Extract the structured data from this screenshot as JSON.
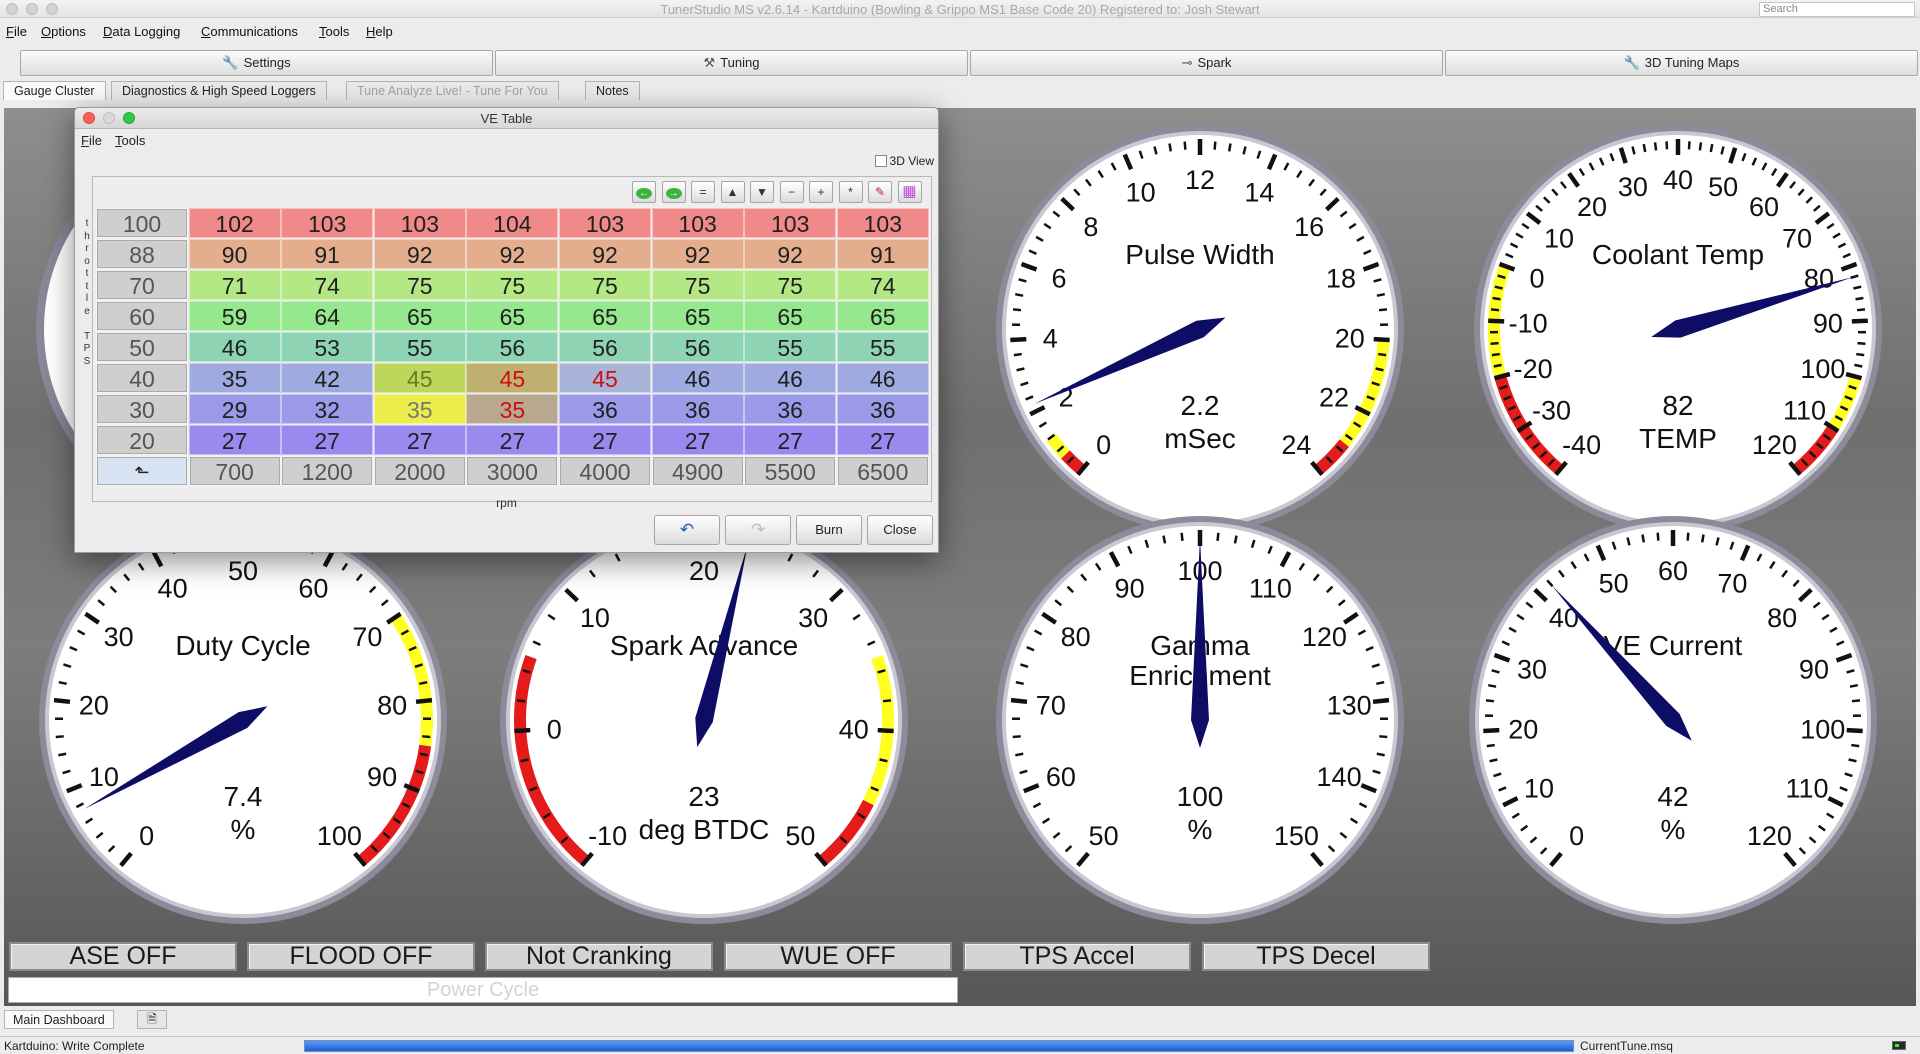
{
  "window": {
    "title": "TunerStudio MS v2.6.14 - Kartduino (Bowling & Grippo MS1 Base Code 20) Registered to: Josh Stewart",
    "search_placeholder": "Search"
  },
  "menubar": [
    "File",
    "Options",
    "Data Logging",
    "Communications",
    "Tools",
    "Help"
  ],
  "top_buttons": [
    {
      "label": "Settings",
      "icon": "wrench-icon"
    },
    {
      "label": "Tuning",
      "icon": "tools-icon"
    },
    {
      "label": "Spark",
      "icon": "spark-plug-icon"
    },
    {
      "label": "3D Tuning Maps",
      "icon": "map-wrench-icon"
    }
  ],
  "tabs": [
    {
      "label": "Gauge Cluster",
      "active": true
    },
    {
      "label": "Diagnostics & High Speed Loggers",
      "active": false
    },
    {
      "label": "Tune Analyze Live! - Tune For You",
      "active": false,
      "disabled": true
    },
    {
      "label": "Notes",
      "active": false
    }
  ],
  "gauges": [
    {
      "title": "Pulse Width",
      "value": "2.2",
      "units": "mSec",
      "min": 0,
      "max": 24,
      "reading": 2.2,
      "ticks": [
        0,
        2,
        4,
        6,
        8,
        10,
        12,
        14,
        16,
        18,
        20,
        22,
        24
      ],
      "zones": [
        {
          "from": 20,
          "to": 23,
          "color": "#ffff22"
        },
        {
          "from": 23,
          "to": 24,
          "color": "#e51a1a"
        },
        {
          "from": 0,
          "to": 0.6,
          "color": "#e51a1a"
        },
        {
          "from": 0.6,
          "to": 1.2,
          "color": "#ffff22"
        }
      ]
    },
    {
      "title": "Coolant Temp",
      "value": "82",
      "units": "TEMP",
      "min": -40,
      "max": 120,
      "reading": 82,
      "ticks": [
        -40,
        -30,
        -20,
        -10,
        0,
        10,
        20,
        30,
        40,
        50,
        60,
        70,
        80,
        90,
        100,
        110,
        120
      ],
      "zones": [
        {
          "from": -40,
          "to": -20,
          "color": "#e51a1a"
        },
        {
          "from": -20,
          "to": 0,
          "color": "#ffff22"
        },
        {
          "from": 100,
          "to": 110,
          "color": "#ffff22"
        },
        {
          "from": 110,
          "to": 120,
          "color": "#e51a1a"
        }
      ]
    },
    {
      "title": "Duty Cycle",
      "value": "7.4",
      "units": "%",
      "min": 0,
      "max": 100,
      "reading": 7.4,
      "ticks": [
        0,
        10,
        20,
        30,
        40,
        50,
        60,
        70,
        80,
        90,
        100
      ],
      "zones": [
        {
          "from": 70,
          "to": 85,
          "color": "#ffff22"
        },
        {
          "from": 85,
          "to": 100,
          "color": "#e51a1a"
        }
      ]
    },
    {
      "title": "Spark Advance",
      "value": "23",
      "units": "deg BTDC",
      "min": -10,
      "max": 50,
      "reading": 23,
      "ticks": [
        -10,
        0,
        10,
        20,
        30,
        40,
        50
      ],
      "zones": [
        {
          "from": -10,
          "to": 5,
          "color": "#e51a1a"
        },
        {
          "from": 35,
          "to": 45,
          "color": "#ffff22"
        },
        {
          "from": 45,
          "to": 50,
          "color": "#e51a1a"
        }
      ]
    },
    {
      "title": "Gamma Enrichment",
      "title_lines": [
        "Gamma",
        "Enrichment"
      ],
      "value": "100",
      "units": "%",
      "min": 50,
      "max": 150,
      "reading": 100,
      "ticks": [
        50,
        60,
        70,
        80,
        90,
        100,
        110,
        120,
        130,
        140,
        150
      ],
      "zones": []
    },
    {
      "title": "VE Current",
      "value": "42",
      "units": "%",
      "min": 0,
      "max": 120,
      "reading": 42,
      "ticks": [
        0,
        10,
        20,
        30,
        40,
        50,
        60,
        70,
        80,
        90,
        100,
        110,
        120
      ],
      "zones": []
    }
  ],
  "indicators": [
    "ASE OFF",
    "FLOOD OFF",
    "Not Cranking",
    "WUE OFF",
    "TPS Accel",
    "TPS Decel"
  ],
  "power_cycle": "Power Cycle",
  "bottom_tab": "Main Dashboard",
  "status": {
    "text": "Kartduino: Write Complete",
    "progress": 1.0,
    "file": "CurrentTune.msq"
  },
  "ve_table": {
    "title": "VE Table",
    "menu": [
      "File",
      "Tools"
    ],
    "view3d_label": "3D View",
    "y_axis_label": "throttle TPS",
    "x_axis_label": "rpm",
    "toolbar": [
      "arrow-left-icon",
      "arrow-right-icon",
      "=",
      "▲",
      "▼",
      "−",
      "+",
      "*",
      "pencil-icon",
      "color-palette-icon"
    ],
    "tps_bins": [
      "100",
      "88",
      "70",
      "60",
      "50",
      "40",
      "30",
      "20"
    ],
    "rpm_bins": [
      "700",
      "1200",
      "2000",
      "3000",
      "4000",
      "4900",
      "5500",
      "6500"
    ],
    "values": [
      [
        "102",
        "103",
        "103",
        "104",
        "103",
        "103",
        "103",
        "103"
      ],
      [
        "90",
        "91",
        "92",
        "92",
        "92",
        "92",
        "92",
        "91"
      ],
      [
        "71",
        "74",
        "75",
        "75",
        "75",
        "75",
        "75",
        "74"
      ],
      [
        "59",
        "64",
        "65",
        "65",
        "65",
        "65",
        "65",
        "65"
      ],
      [
        "46",
        "53",
        "55",
        "56",
        "56",
        "56",
        "55",
        "55"
      ],
      [
        "35",
        "42",
        "45",
        "45",
        "45",
        "46",
        "46",
        "46"
      ],
      [
        "29",
        "32",
        "35",
        "35",
        "36",
        "36",
        "36",
        "36"
      ],
      [
        "27",
        "27",
        "27",
        "27",
        "27",
        "27",
        "27",
        "27"
      ]
    ],
    "row_colors": [
      "#f08a8a",
      "#e4ae8e",
      "#b4e884",
      "#96e88e",
      "#8ed4b4",
      "#9eaae0",
      "#9a9ae8",
      "#9a8aef"
    ],
    "highlight_cells": [
      {
        "row": 5,
        "col": 2,
        "color": "#bfd65c",
        "text_color": "#6a7c1c"
      },
      {
        "row": 5,
        "col": 3,
        "color": "#c0b070",
        "text_color": "#cc1010"
      },
      {
        "row": 5,
        "col": 4,
        "color": "#a8b4d8",
        "text_color": "#cc1010"
      },
      {
        "row": 6,
        "col": 2,
        "color": "#ecec4a",
        "text_color": "#777"
      },
      {
        "row": 6,
        "col": 3,
        "color": "#b8a890",
        "text_color": "#cc1010"
      }
    ],
    "buttons": {
      "undo": "undo-icon",
      "redo": "redo-icon",
      "burn": "Burn",
      "close": "Close"
    }
  }
}
